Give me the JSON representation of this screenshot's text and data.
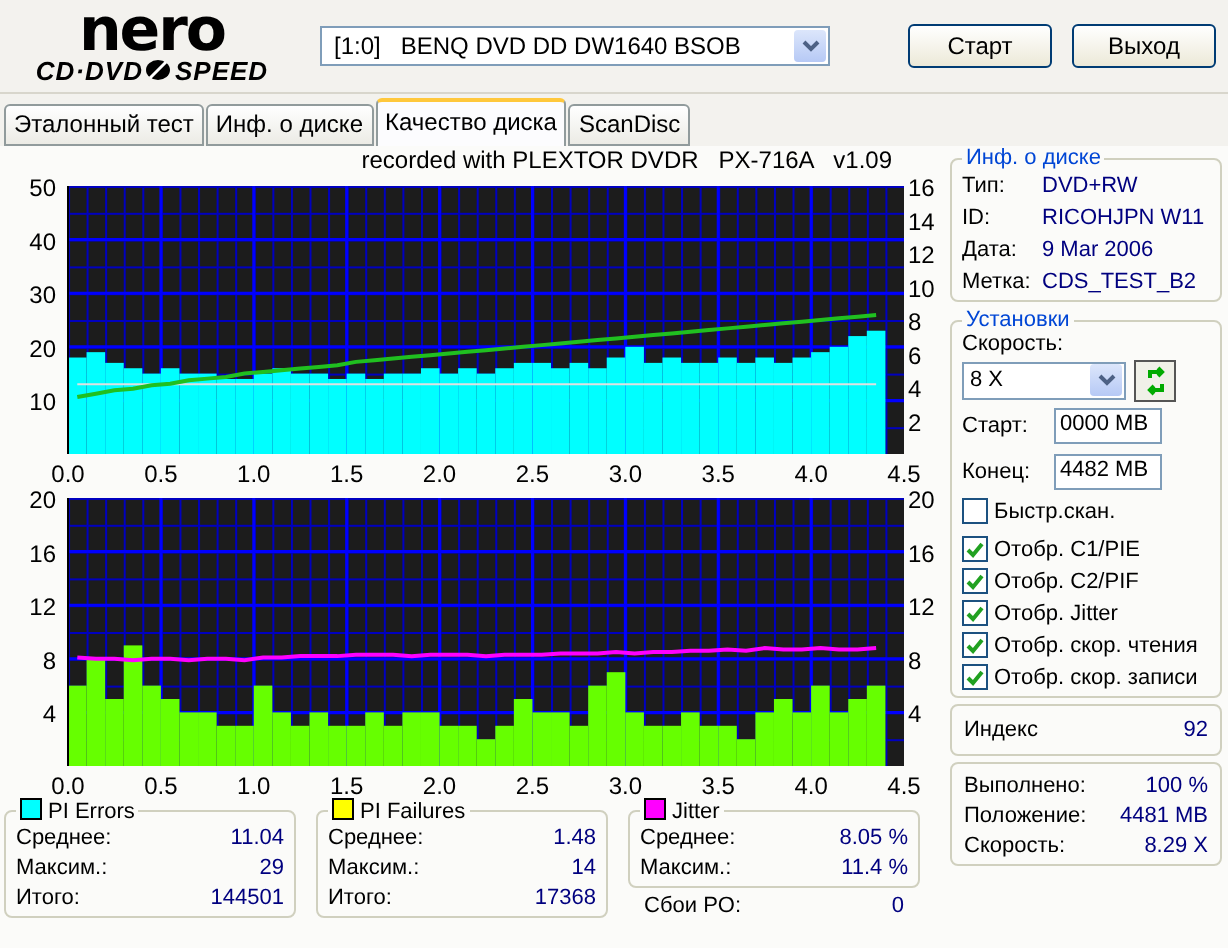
{
  "logo": {
    "word": "nero",
    "left": "CD·DVD",
    "right": "SPEED"
  },
  "drive": {
    "value": "[1:0]   BENQ DVD DD DW1640 BSOB"
  },
  "buttons": [
    "Старт",
    "Выход"
  ],
  "tabs": [
    {
      "label": "Эталонный тест",
      "selected": false
    },
    {
      "label": "Инф. о диске",
      "selected": false
    },
    {
      "label": "Качество диска",
      "selected": true
    },
    {
      "label": "ScanDisc",
      "selected": false
    }
  ],
  "chart_caption": "recorded with PLEXTOR DVDR   PX-716A   v1.09",
  "charts": [
    {
      "chart_data": {
        "type": "bar",
        "x": [
          0.05,
          0.15,
          0.25,
          0.35,
          0.45,
          0.55,
          0.65,
          0.75,
          0.85,
          0.95,
          1.05,
          1.15,
          1.25,
          1.35,
          1.45,
          1.55,
          1.65,
          1.75,
          1.85,
          1.95,
          2.05,
          2.15,
          2.25,
          2.35,
          2.45,
          2.55,
          2.65,
          2.75,
          2.85,
          2.95,
          3.05,
          3.15,
          3.25,
          3.35,
          3.45,
          3.55,
          3.65,
          3.75,
          3.85,
          3.95,
          4.05,
          4.15,
          4.25,
          4.35
        ],
        "xlim": [
          0,
          4.5
        ],
        "ylim": [
          0,
          50
        ],
        "y2lim": [
          0,
          16
        ],
        "xticks": [
          {
            "value": 0,
            "label": "0.0"
          },
          {
            "value": 0.5,
            "label": "0.5"
          },
          {
            "value": 1,
            "label": "1.0"
          },
          {
            "value": 1.5,
            "label": "1.5"
          },
          {
            "value": 2,
            "label": "2.0"
          },
          {
            "value": 2.5,
            "label": "2.5"
          },
          {
            "value": 3,
            "label": "3.0"
          },
          {
            "value": 3.5,
            "label": "3.5"
          },
          {
            "value": 4,
            "label": "4.0"
          },
          {
            "value": 4.5,
            "label": "4.5"
          }
        ],
        "yticks": [
          10,
          20,
          30,
          40,
          50
        ],
        "y2ticks": [
          2,
          4,
          6,
          8,
          10,
          12,
          14,
          16
        ],
        "series": [
          {
            "color": "#00ffff",
            "type": "bar",
            "values": [
              18,
              19,
              17,
              16,
              15,
              16,
              15,
              15,
              14,
              14,
              15,
              16,
              15,
              15,
              14,
              15,
              14,
              15,
              15,
              16,
              15,
              16,
              15,
              16,
              17,
              17,
              16,
              17,
              16,
              18,
              20,
              17,
              18,
              17,
              17,
              18,
              17,
              18,
              17,
              18,
              19,
              20,
              22,
              23
            ]
          },
          {
            "color": "#e0e0e0",
            "type": "line",
            "values": [
              13,
              13,
              13,
              13,
              13,
              13,
              13,
              13,
              13,
              13,
              13,
              13,
              13,
              13,
              13,
              13,
              13,
              13,
              13,
              13,
              13,
              13,
              13,
              13,
              13,
              13,
              13,
              13,
              13,
              13,
              13,
              13,
              13,
              13,
              13,
              13,
              13,
              13,
              13,
              13,
              13,
              13,
              13,
              13
            ]
          },
          {
            "color": "#20c020",
            "type": "line",
            "axis": "y2",
            "values": [
              3.4,
              3.6,
              3.8,
              3.9,
              4.1,
              4.2,
              4.4,
              4.5,
              4.6,
              4.8,
              4.9,
              5.0,
              5.1,
              5.2,
              5.3,
              5.5,
              5.6,
              5.7,
              5.8,
              5.9,
              6.0,
              6.1,
              6.2,
              6.3,
              6.4,
              6.5,
              6.6,
              6.7,
              6.8,
              6.9,
              7.0,
              7.1,
              7.2,
              7.3,
              7.4,
              7.5,
              7.6,
              7.7,
              7.8,
              7.9,
              8.0,
              8.1,
              8.2,
              8.3
            ]
          }
        ],
        "grid": true
      }
    },
    {
      "chart_data": {
        "type": "bar",
        "x": [
          0.05,
          0.15,
          0.25,
          0.35,
          0.45,
          0.55,
          0.65,
          0.75,
          0.85,
          0.95,
          1.05,
          1.15,
          1.25,
          1.35,
          1.45,
          1.55,
          1.65,
          1.75,
          1.85,
          1.95,
          2.05,
          2.15,
          2.25,
          2.35,
          2.45,
          2.55,
          2.65,
          2.75,
          2.85,
          2.95,
          3.05,
          3.15,
          3.25,
          3.35,
          3.45,
          3.55,
          3.65,
          3.75,
          3.85,
          3.95,
          4.05,
          4.15,
          4.25,
          4.35
        ],
        "xlim": [
          0,
          4.5
        ],
        "ylim": [
          0,
          20
        ],
        "y2lim": [
          0,
          20
        ],
        "xticks": [
          {
            "value": 0,
            "label": "0.0"
          },
          {
            "value": 0.5,
            "label": "0.5"
          },
          {
            "value": 1,
            "label": "1.0"
          },
          {
            "value": 1.5,
            "label": "1.5"
          },
          {
            "value": 2,
            "label": "2.0"
          },
          {
            "value": 2.5,
            "label": "2.5"
          },
          {
            "value": 3,
            "label": "3.0"
          },
          {
            "value": 3.5,
            "label": "3.5"
          },
          {
            "value": 4,
            "label": "4.0"
          },
          {
            "value": 4.5,
            "label": "4.5"
          }
        ],
        "yticks": [
          4,
          8,
          12,
          16,
          20
        ],
        "y2ticks": [
          4,
          8,
          12,
          16,
          20
        ],
        "grid": true,
        "series": [
          {
            "color": "#66ff00",
            "type": "bar",
            "values": [
              6,
              8,
              5,
              9,
              6,
              5,
              4,
              4,
              3,
              3,
              6,
              4,
              3,
              4,
              3,
              3,
              4,
              3,
              4,
              4,
              3,
              3,
              2,
              3,
              5,
              4,
              4,
              3,
              6,
              7,
              4,
              3,
              3,
              4,
              3,
              3,
              2,
              4,
              5,
              4,
              6,
              4,
              5,
              6
            ]
          },
          {
            "color": "#ff00ff",
            "type": "line",
            "axis": "y2",
            "values": [
              8.1,
              8.0,
              8.0,
              7.9,
              8.0,
              8.0,
              7.9,
              8.0,
              8.0,
              7.9,
              8.1,
              8.1,
              8.2,
              8.2,
              8.2,
              8.3,
              8.3,
              8.3,
              8.2,
              8.3,
              8.3,
              8.3,
              8.2,
              8.3,
              8.3,
              8.3,
              8.4,
              8.4,
              8.4,
              8.5,
              8.4,
              8.5,
              8.5,
              8.6,
              8.6,
              8.7,
              8.6,
              8.8,
              8.7,
              8.7,
              8.8,
              8.7,
              8.7,
              8.8
            ]
          }
        ]
      }
    }
  ],
  "disc_info": {
    "title": "Инф. о диске",
    "rows": [
      {
        "label": "Тип:",
        "value": "DVD+RW"
      },
      {
        "label": "ID:",
        "value": "RICOHJPN W11"
      },
      {
        "label": "Дата:",
        "value": "9 Mar 2006"
      },
      {
        "label": "Метка:",
        "value": "CDS_TEST_B2"
      }
    ]
  },
  "settings": {
    "title": "Установки",
    "speed_label": "Скорость:",
    "speed_value": "8 X",
    "start_label": "Старт:",
    "start_value": "0000 MB",
    "end_label": "Конец:",
    "end_value": "4482 MB",
    "checkboxes": [
      {
        "label": "Быстр.скан.",
        "checked": false
      },
      {
        "label": "Отобр. C1/PIE",
        "checked": true
      },
      {
        "label": "Отобр. C2/PIF",
        "checked": true
      },
      {
        "label": "Отобр. Jitter",
        "checked": true
      },
      {
        "label": "Отобр. скор. чтения",
        "checked": true
      },
      {
        "label": "Отобр. скор. записи",
        "checked": true
      }
    ]
  },
  "index": {
    "label": "Индекс",
    "value": "92"
  },
  "progress": [
    {
      "label": "Выполнено:",
      "value": "100 %"
    },
    {
      "label": "Положение:",
      "value": "4481 MB"
    },
    {
      "label": "Скорость:",
      "value": "8.29 X"
    }
  ],
  "stats": [
    {
      "title": "PI Errors",
      "color": "#00ffff",
      "rows": [
        {
          "label": "Среднее:",
          "value": "11.04"
        },
        {
          "label": "Максим.:",
          "value": "29"
        },
        {
          "label": "Итого:",
          "value": "144501"
        }
      ]
    },
    {
      "title": "PI Failures",
      "color": "#ffff00",
      "rows": [
        {
          "label": "Среднее:",
          "value": "1.48"
        },
        {
          "label": "Максим.:",
          "value": "14"
        },
        {
          "label": "Итого:",
          "value": "17368"
        }
      ]
    },
    {
      "title": "Jitter",
      "color": "#ff00ff",
      "rows": [
        {
          "label": "Среднее:",
          "value": "8.05 %"
        },
        {
          "label": "Максим.:",
          "value": "11.4 %"
        }
      ],
      "extra": {
        "label": "Сбои PO:",
        "value": "0"
      }
    }
  ]
}
